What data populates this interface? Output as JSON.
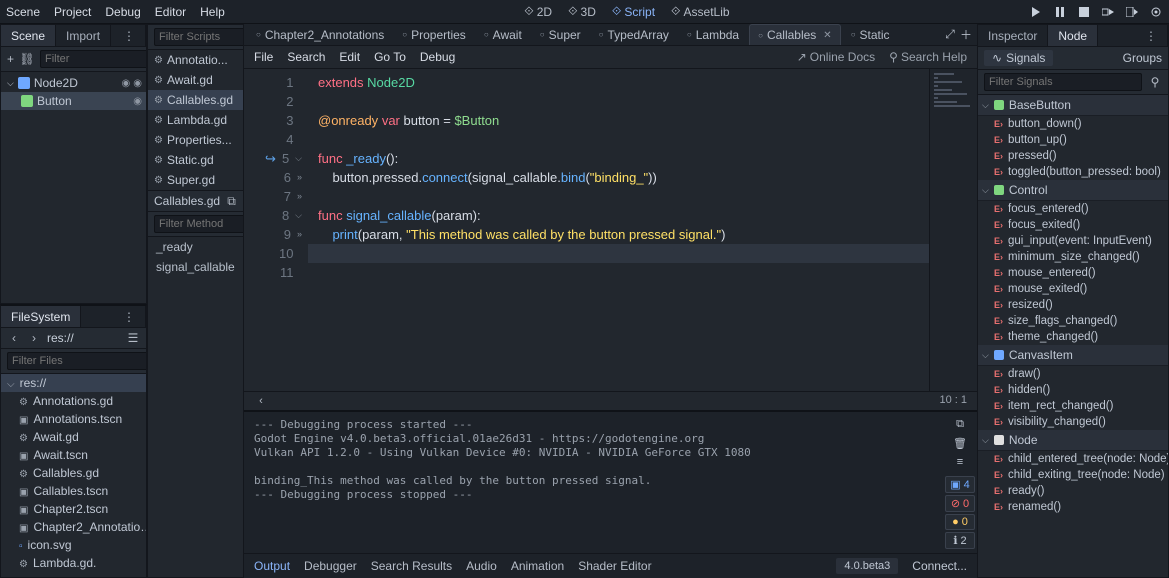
{
  "menubar": {
    "items": [
      "Scene",
      "Project",
      "Debug",
      "Editor",
      "Help"
    ]
  },
  "workspace_switcher": [
    {
      "label": "2D",
      "icon": "arrows-icon"
    },
    {
      "label": "3D",
      "icon": "cube-icon"
    },
    {
      "label": "Script",
      "icon": "script-icon",
      "active": true
    },
    {
      "label": "AssetLib",
      "icon": "download-icon"
    }
  ],
  "playback_icons": [
    "play-icon",
    "pause-icon",
    "stop-icon",
    "play-scene-icon",
    "play-custom-icon",
    "movie-icon"
  ],
  "left": {
    "tabs": [
      "Scene",
      "Import"
    ],
    "filter_placeholder": "Filter",
    "tree": [
      {
        "name": "Node2D",
        "icon": "node2d-icon",
        "indent": 0,
        "extra": [
          "visibility-icon",
          "script-attached-icon"
        ]
      },
      {
        "name": "Button",
        "icon": "button-node-icon",
        "indent": 1,
        "selected": true,
        "extra": [
          "visibility-icon"
        ]
      }
    ]
  },
  "filesystem": {
    "title": "FileSystem",
    "path": "res://",
    "filter_placeholder": "Filter Files",
    "root": "res://",
    "items": [
      {
        "name": "Annotations.gd",
        "type": "gd"
      },
      {
        "name": "Annotations.tscn",
        "type": "tscn"
      },
      {
        "name": "Await.gd",
        "type": "gd"
      },
      {
        "name": "Await.tscn",
        "type": "tscn"
      },
      {
        "name": "Callables.gd",
        "type": "gd"
      },
      {
        "name": "Callables.tscn",
        "type": "tscn"
      },
      {
        "name": "Chapter2.tscn",
        "type": "tscn"
      },
      {
        "name": "Chapter2_Annotatio…",
        "type": "tscn"
      },
      {
        "name": "icon.svg",
        "type": "svg"
      },
      {
        "name": "Lambda.gd.",
        "type": "gd"
      }
    ]
  },
  "scriptcol": {
    "filter_scripts_placeholder": "Filter Scripts",
    "scripts": [
      {
        "name": "Annotatio..."
      },
      {
        "name": "Await.gd"
      },
      {
        "name": "Callables.gd",
        "selected": true
      },
      {
        "name": "Lambda.gd"
      },
      {
        "name": "Properties..."
      },
      {
        "name": "Static.gd"
      },
      {
        "name": "Super.gd"
      }
    ],
    "current_file": "Callables.gd",
    "filter_methods_placeholder": "Filter Method",
    "methods": [
      "_ready",
      "signal_callable"
    ]
  },
  "editor": {
    "tabs": [
      {
        "label": "Chapter2_Annotations"
      },
      {
        "label": "Properties"
      },
      {
        "label": "Await"
      },
      {
        "label": "Super"
      },
      {
        "label": "TypedArray"
      },
      {
        "label": "Lambda"
      },
      {
        "label": "Callables",
        "active": true,
        "closable": true
      },
      {
        "label": "Static"
      }
    ],
    "menu": [
      "File",
      "Search",
      "Edit",
      "Go To",
      "Debug"
    ],
    "online_docs": "Online Docs",
    "search_help": "Search Help",
    "lines": [
      {
        "n": 1,
        "tokens": [
          [
            "kw",
            "extends"
          ],
          [
            "plain",
            " "
          ],
          [
            "type",
            "Node2D"
          ]
        ]
      },
      {
        "n": 2,
        "tokens": []
      },
      {
        "n": 3,
        "tokens": [
          [
            "ann",
            "@onready"
          ],
          [
            "plain",
            " "
          ],
          [
            "kw",
            "var"
          ],
          [
            "plain",
            " button = "
          ],
          [
            "nodep",
            "$Button"
          ]
        ]
      },
      {
        "n": 4,
        "tokens": []
      },
      {
        "n": 5,
        "fold": true,
        "break": true,
        "tokens": [
          [
            "kw",
            "func"
          ],
          [
            "plain",
            " "
          ],
          [
            "fn",
            "_ready"
          ],
          [
            "plain",
            "():"
          ]
        ]
      },
      {
        "n": 6,
        "indent": true,
        "tokens": [
          [
            "plain",
            "    button.pressed."
          ],
          [
            "fn",
            "connect"
          ],
          [
            "plain",
            "(signal_callable."
          ],
          [
            "fn",
            "bind"
          ],
          [
            "plain",
            "("
          ],
          [
            "str",
            "\"binding_\""
          ],
          [
            "plain",
            "))"
          ]
        ]
      },
      {
        "n": 7,
        "indent": true,
        "tokens": []
      },
      {
        "n": 8,
        "fold": true,
        "tokens": [
          [
            "kw",
            "func"
          ],
          [
            "plain",
            " "
          ],
          [
            "fn",
            "signal_callable"
          ],
          [
            "plain",
            "(param):"
          ]
        ]
      },
      {
        "n": 9,
        "indent": true,
        "tokens": [
          [
            "plain",
            "    "
          ],
          [
            "fn",
            "print"
          ],
          [
            "plain",
            "(param, "
          ],
          [
            "str",
            "\"This method was called by the button pressed signal.\""
          ],
          [
            "plain",
            ")"
          ]
        ]
      },
      {
        "n": 10,
        "hl": true,
        "tokens": []
      },
      {
        "n": 11,
        "tokens": []
      }
    ],
    "cursor": "10 :  1"
  },
  "output": {
    "text": "--- Debugging process started ---\nGodot Engine v4.0.beta3.official.01ae26d31 - https://godotengine.org\nVulkan API 1.2.0 - Using Vulkan Device #0: NVIDIA - NVIDIA GeForce GTX 1080\n\nbinding_This method was called by the button pressed signal.\n--- Debugging process stopped ---",
    "counts": {
      "messages": 4,
      "errors": 0,
      "warnings": 0,
      "info": 2
    },
    "tabs": [
      "Output",
      "Debugger",
      "Search Results",
      "Audio",
      "Animation",
      "Shader Editor"
    ],
    "version": "4.0.beta3",
    "connect": "Connect..."
  },
  "right": {
    "tabs": [
      "Inspector",
      "Node"
    ],
    "modes": {
      "signals": "Signals",
      "groups": "Groups"
    },
    "filter_placeholder": "Filter Signals",
    "categories": [
      {
        "name": "BaseButton",
        "iconClass": "ci-base",
        "signals": [
          "button_down()",
          "button_up()",
          "pressed()",
          "toggled(button_pressed: bool)"
        ]
      },
      {
        "name": "Control",
        "iconClass": "ci-control",
        "signals": [
          "focus_entered()",
          "focus_exited()",
          "gui_input(event: InputEvent)",
          "minimum_size_changed()",
          "mouse_entered()",
          "mouse_exited()",
          "resized()",
          "size_flags_changed()",
          "theme_changed()"
        ]
      },
      {
        "name": "CanvasItem",
        "iconClass": "ci-canvas",
        "signals": [
          "draw()",
          "hidden()",
          "item_rect_changed()",
          "visibility_changed()"
        ]
      },
      {
        "name": "Node",
        "iconClass": "ci-node",
        "signals": [
          "child_entered_tree(node: Node)",
          "child_exiting_tree(node: Node)",
          "ready()",
          "renamed()"
        ]
      }
    ]
  }
}
